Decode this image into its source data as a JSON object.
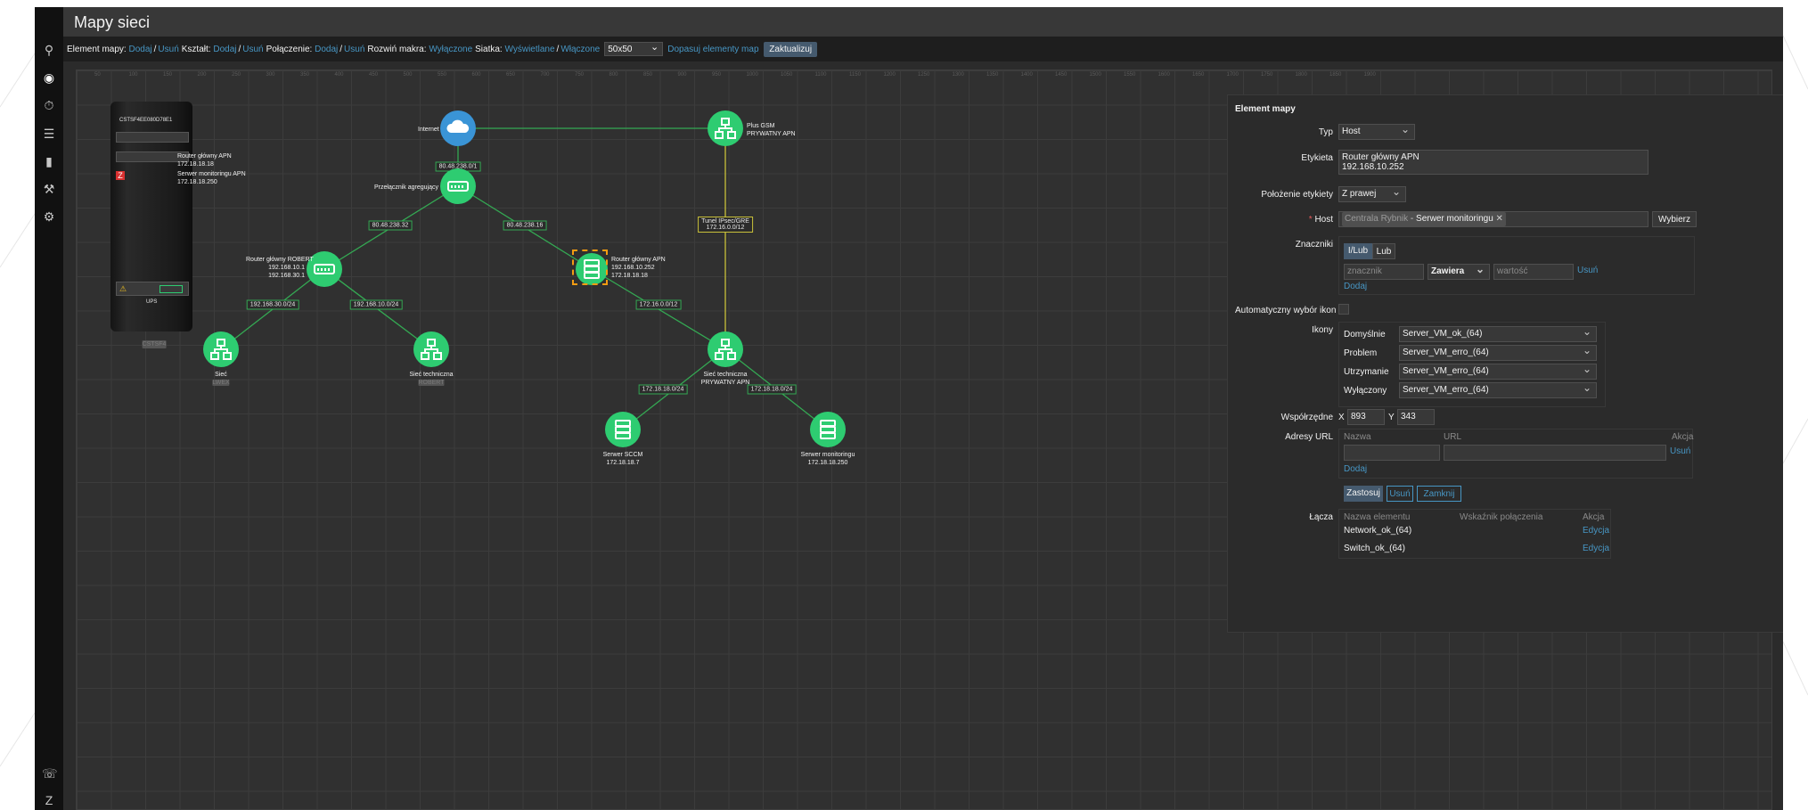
{
  "page": {
    "title": "Mapy sieci"
  },
  "toolbar": {
    "element_label": "Element mapy:",
    "element_add": "Dodaj",
    "element_remove": "Usuń",
    "shape_label": "Kształt:",
    "shape_add": "Dodaj",
    "shape_remove": "Usuń",
    "link_label": "Połączenie:",
    "link_add": "Dodaj",
    "link_remove": "Usuń",
    "macros_label": "Rozwiń makra:",
    "macros_value": "Wyłączone",
    "grid_label": "Siatka:",
    "grid_shown": "Wyświetlane",
    "grid_on": "Włączone",
    "grid_size": "50x50",
    "fit_label": "Dopasuj elementy map",
    "update_label": "Zaktualizuj"
  },
  "ruler": [
    "50",
    "100",
    "150",
    "200",
    "250",
    "300",
    "350",
    "400",
    "450",
    "500",
    "550",
    "600",
    "650",
    "700",
    "750",
    "800",
    "850",
    "900",
    "950",
    "1000",
    "1050",
    "1100",
    "1150",
    "1200",
    "1250",
    "1300",
    "1350",
    "1400",
    "1450",
    "1500",
    "1550",
    "1600",
    "1650",
    "1700",
    "1750",
    "1800",
    "1850",
    "1900"
  ],
  "map": {
    "rack": {
      "title": "CSTSF4EE080D78E1",
      "ups": "UPS",
      "sub": "CSTSF4"
    },
    "rack_router": {
      "name": "Router główny APN",
      "ip": "172.18.18.18"
    },
    "rack_server": {
      "name": "Serwer monitoringu APN",
      "ip": "172.18.18.250"
    },
    "internet": {
      "name": "Internet"
    },
    "internet_link": "80.48.238.0/1",
    "plus_gsm": {
      "name": "Plus GSM",
      "sub": "PRYWATNY APN"
    },
    "switch": {
      "name": "Przełącznik agregujący"
    },
    "link_left": "80.48.238.32",
    "link_right": "80.48.238.16",
    "tunnel": {
      "line1": "Tunel IPsec/GRE",
      "line2": "172.16.0.0/12"
    },
    "router_left": {
      "name": "Router główny ROBERT",
      "ip1": "192.168.10.1",
      "ip2": "192.168.30.1"
    },
    "router_apn": {
      "name": "Router główny APN",
      "ip1": "192.168.10.252",
      "ip2": "172.18.18.18"
    },
    "link_30": "192.168.30.0/24",
    "link_10": "192.168.10.0/24",
    "link_172": "172.16.0.0/12",
    "net": {
      "name": "Sieć",
      "sub": "LWEX"
    },
    "tech_net": {
      "name": "Sieć techniczna",
      "sub": "ROBERT"
    },
    "tech_apn": {
      "name": "Sieć techniczna",
      "sub": "PRYWATNY APN"
    },
    "link_sccm": "172.18.18.0/24",
    "link_mon": "172.18.18.0/24",
    "sccm": {
      "name": "Serwer SCCM",
      "ip": "172.18.18.7"
    },
    "mon": {
      "name": "Serwer monitoringu",
      "ip": "172.18.18.250"
    }
  },
  "panel": {
    "title": "Element mapy",
    "type_label": "Typ",
    "type_value": "Host",
    "label_label": "Etykieta",
    "label_line1": "Router główny APN",
    "label_line2": "192.168.10.252",
    "label_pos_label": "Położenie etykiety",
    "label_pos_value": "Z prawej",
    "host_label": "Host",
    "host_value": "Serwer monitoringu",
    "host_prefix": "Centrala Rybnik",
    "host_select": "Wybierz",
    "tags_label": "Znaczniki",
    "tags_and": "I/Lub",
    "tags_or": "Lub",
    "tag_placeholder": "znacznik",
    "tag_op": "Zawiera",
    "tag_value_placeholder": "wartość",
    "tag_remove": "Usuń",
    "tag_add": "Dodaj",
    "auto_icon_label": "Automatyczny wybór ikon",
    "icons_label": "Ikony",
    "icons": [
      {
        "state": "Domyślnie",
        "icon": "Server_VM_ok_(64)"
      },
      {
        "state": "Problem",
        "icon": "Server_VM_erro_(64)"
      },
      {
        "state": "Utrzymanie",
        "icon": "Server_VM_erro_(64)"
      },
      {
        "state": "Wyłączony",
        "icon": "Server_VM_erro_(64)"
      }
    ],
    "coords_label": "Współrzędne",
    "x_label": "X",
    "x_value": "893",
    "y_label": "Y",
    "y_value": "343",
    "urls_label": "Adresy URL",
    "url_name_hdr": "Nazwa",
    "url_url_hdr": "URL",
    "url_action_hdr": "Akcja",
    "url_remove": "Usuń",
    "url_add": "Dodaj",
    "apply": "Zastosuj",
    "remove": "Usuń",
    "close": "Zamknij",
    "links_label": "Łącza",
    "links_hdr_name": "Nazwa elementu",
    "links_hdr_ind": "Wskaźnik połączenia",
    "links_hdr_action": "Akcja",
    "links": [
      {
        "name": "Network_ok_(64)",
        "action": "Edycja"
      },
      {
        "name": "Switch_ok_(64)",
        "action": "Edycja"
      }
    ]
  },
  "colors": {
    "accent": "#4796c4",
    "node": "#2ecc71",
    "link": "#34a853",
    "tunnel": "#c9c13a",
    "cloud": "#3a94d6"
  }
}
